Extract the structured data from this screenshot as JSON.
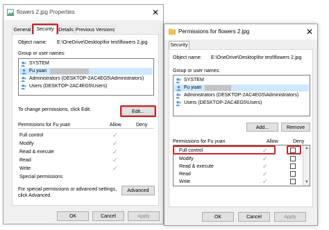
{
  "left": {
    "title": "flowers 2.jpg Properties",
    "tabs": [
      "General",
      "Security",
      "Details",
      "Previous Versions"
    ],
    "object_name_label": "Object name:",
    "object_name_value": "E:\\OneDrive\\Desktop\\for test\\flowers 2.jpg",
    "group_label": "Group or user names:",
    "users": [
      "SYSTEM",
      "Fu yuan",
      "Administrators (DESKTOP-2AC4EG5\\Administrators)",
      "Users (DESKTOP-2AC4EG5\\Users)"
    ],
    "change_text": "To change permissions, click Edit.",
    "edit_button": "Edit...",
    "perm_header": "Permissions for Fu yuan",
    "allow_header": "Allow",
    "deny_header": "Deny",
    "permissions": [
      "Full control",
      "Modify",
      "Read & execute",
      "Read",
      "Write",
      "Special permissions"
    ],
    "special_text_1": "For special permissions or advanced settings,",
    "special_text_2": "click Advanced.",
    "advanced_button": "Advanced",
    "ok": "OK",
    "cancel": "Cancel",
    "apply": "Apply"
  },
  "right": {
    "title": "Permissions for flowers 2.jpg",
    "tab": "Security",
    "object_name_label": "Object name:",
    "object_name_value": "E:\\OneDrive\\Desktop\\for test\\flowers 2.jpg",
    "group_label": "Group or user names:",
    "users": [
      "SYSTEM",
      "Fu yuan",
      "Administrators (DESKTOP-2AC4EG5\\Administrators)",
      "Users (DESKTOP-2AC4EG5\\Users)"
    ],
    "add_button": "Add...",
    "remove_button": "Remove",
    "perm_header": "Permissions for Fu yuan",
    "allow_header": "Allow",
    "deny_header": "Deny",
    "permissions": [
      "Full control",
      "Modify",
      "Read & execute",
      "Read",
      "Write"
    ],
    "ok": "OK",
    "cancel": "Cancel",
    "apply": "Apply"
  },
  "colors": {
    "highlight": "#d81e1e",
    "window_bg": "#f0f0f0",
    "selected_row": "#cde8ff"
  }
}
